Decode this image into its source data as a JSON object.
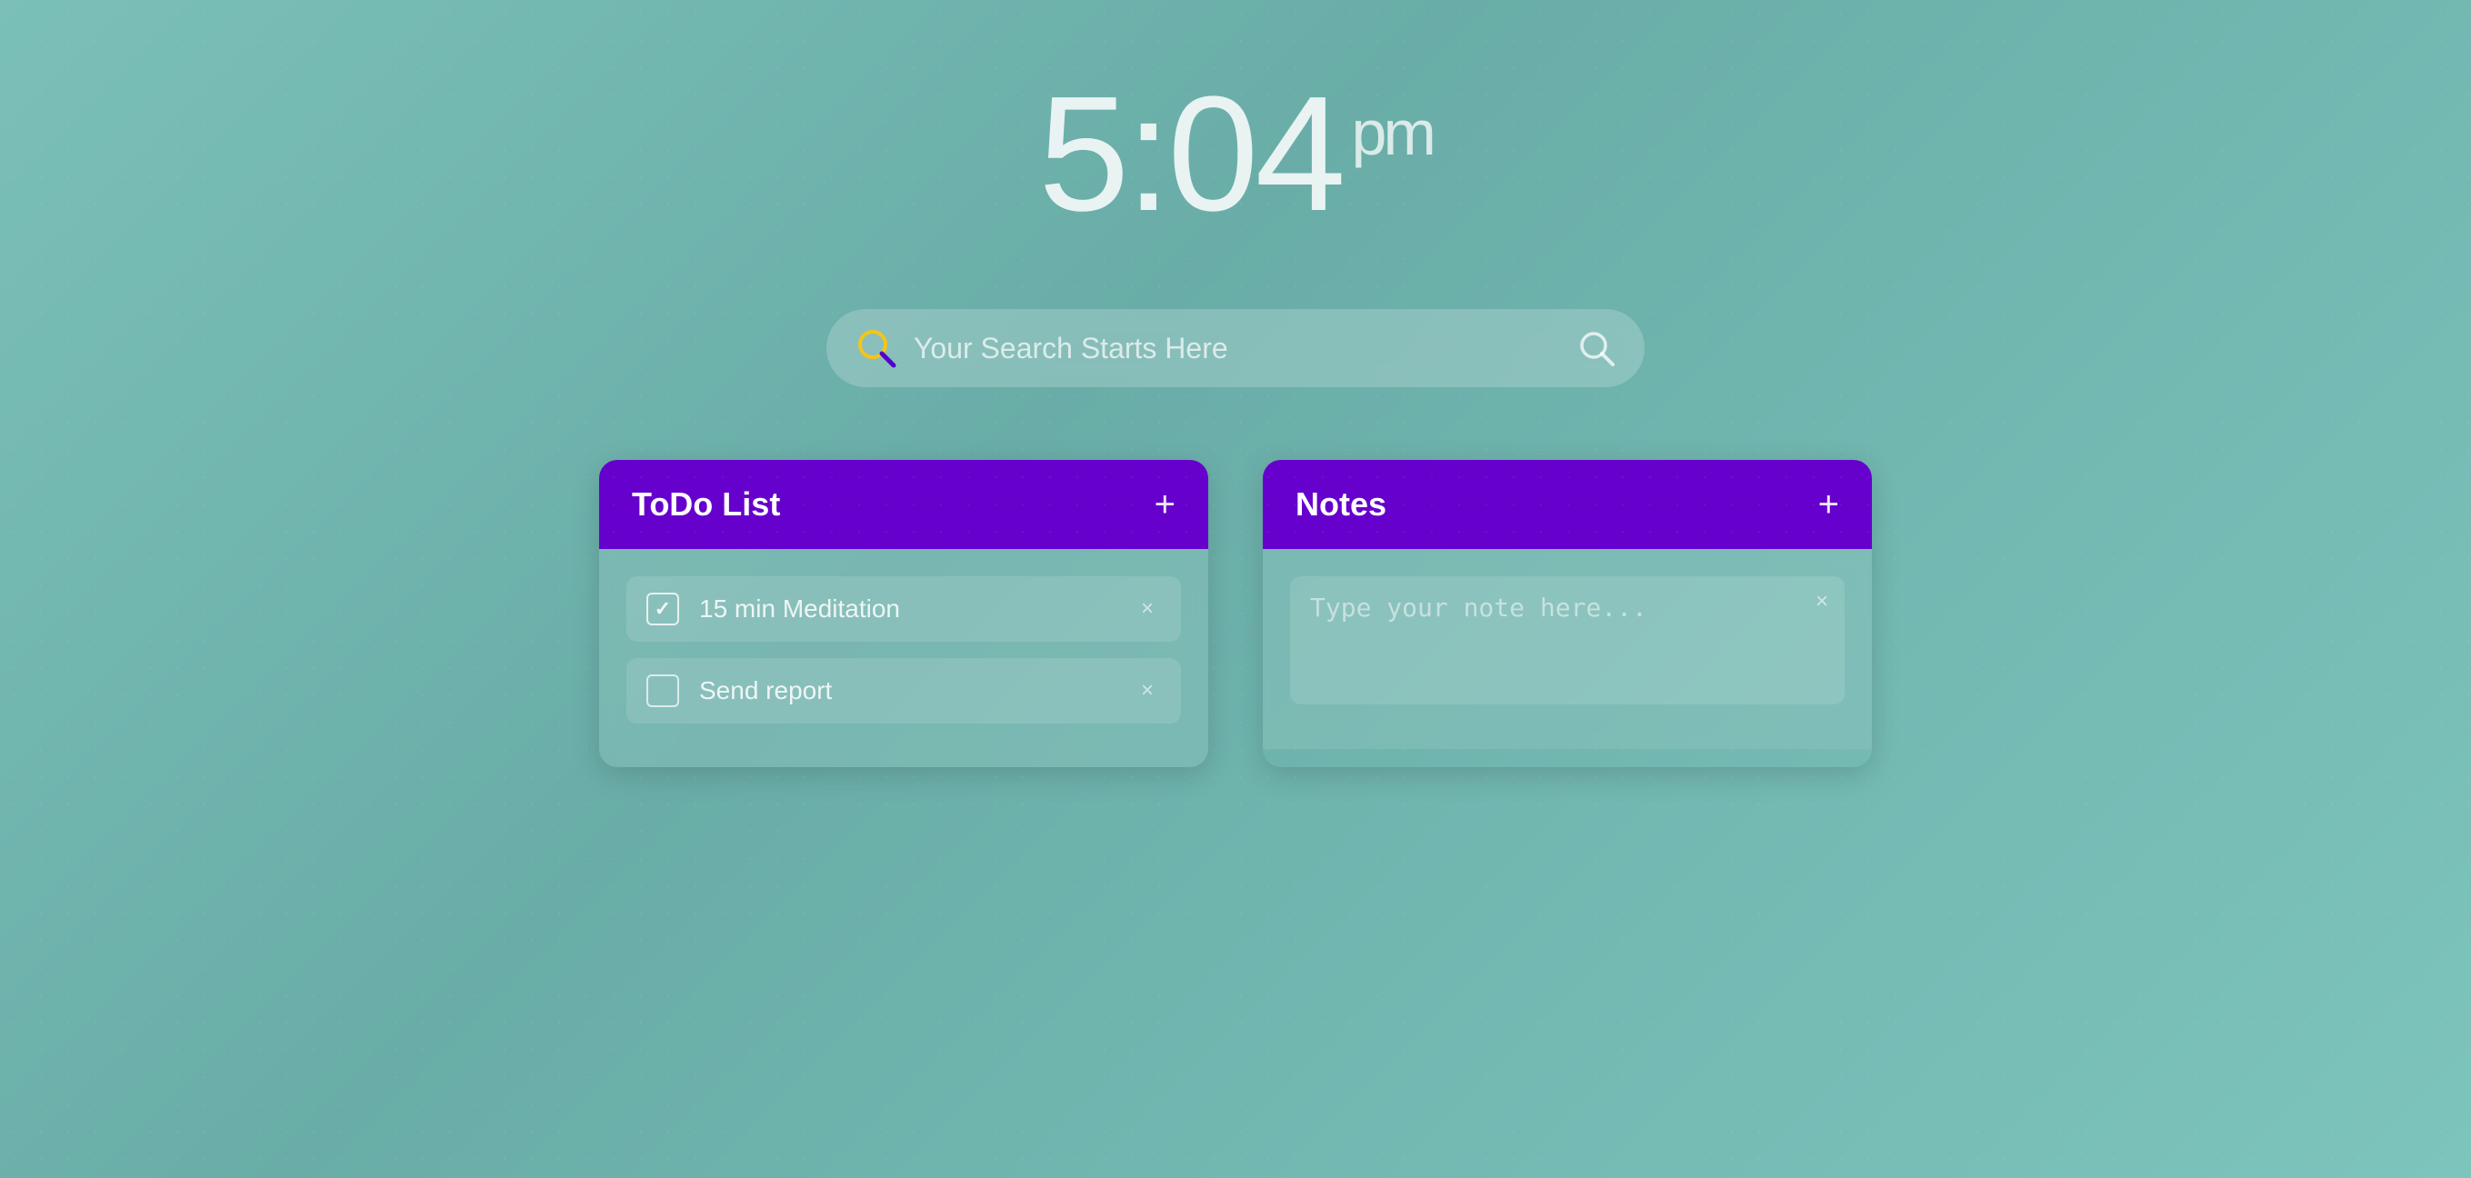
{
  "clock": {
    "time": "5:04",
    "ampm": "pm"
  },
  "search": {
    "placeholder": "Your Search Starts Here",
    "value": ""
  },
  "todo": {
    "title": "ToDo List",
    "add_label": "+",
    "items": [
      {
        "id": 1,
        "text": "15 min Meditation",
        "checked": true
      },
      {
        "id": 2,
        "text": "Send report",
        "checked": false
      }
    ]
  },
  "notes": {
    "title": "Notes",
    "add_label": "+",
    "placeholder": "Type your note here...",
    "value": ""
  },
  "icons": {
    "search_left": "search-magnifier-colored",
    "search_right": "search-magnifier-white",
    "delete": "×"
  }
}
